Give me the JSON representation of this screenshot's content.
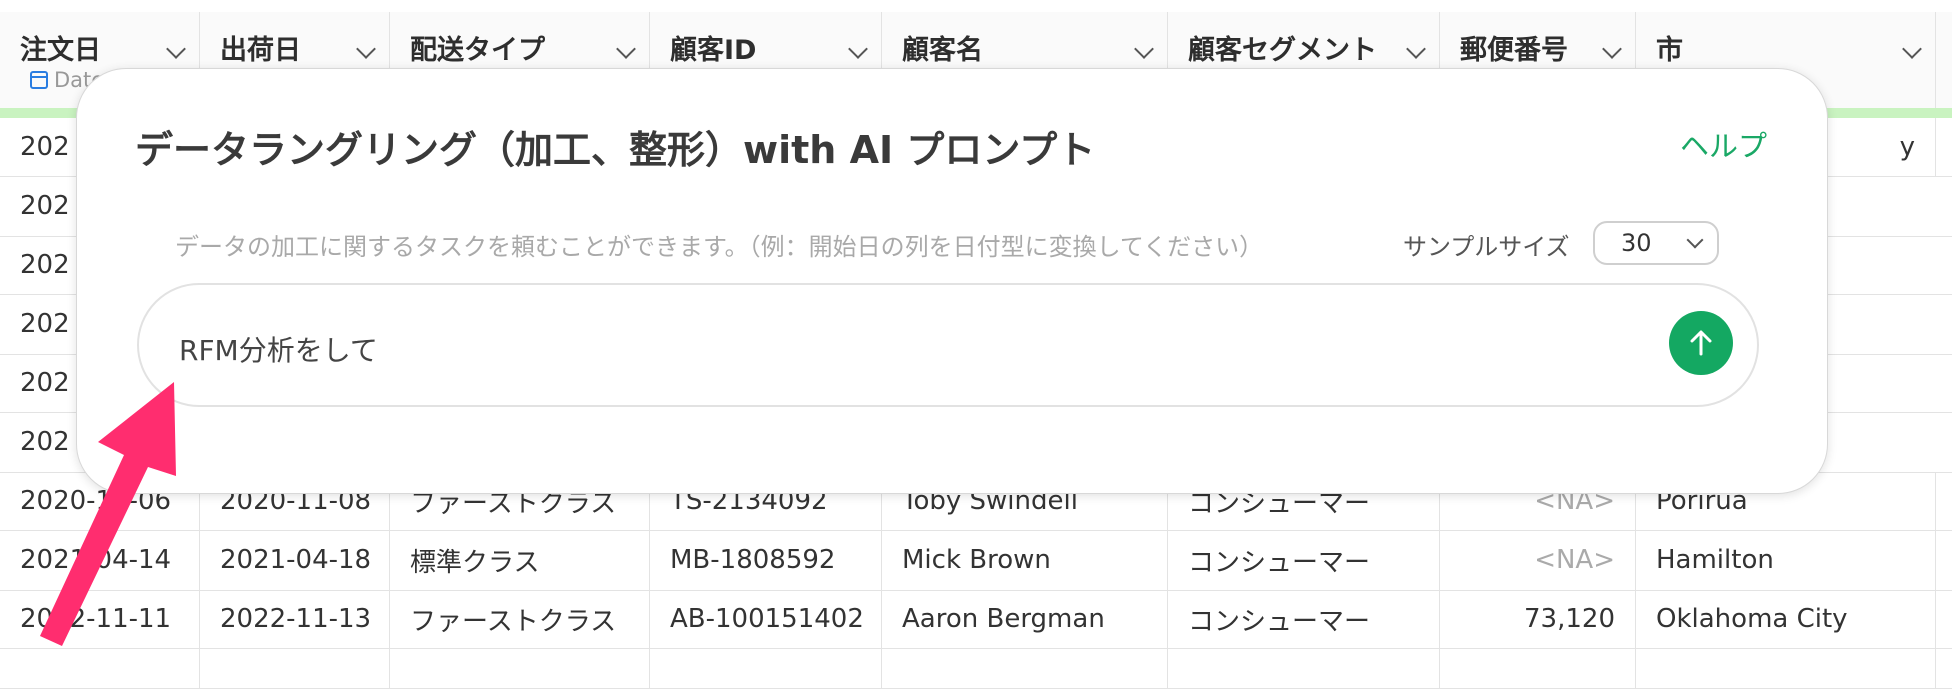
{
  "table": {
    "columns": [
      {
        "label": "注文日"
      },
      {
        "label": "出荷日"
      },
      {
        "label": "配送タイプ"
      },
      {
        "label": "顧客ID"
      },
      {
        "label": "顧客名"
      },
      {
        "label": "顧客セグメント"
      },
      {
        "label": "郵便番号"
      },
      {
        "label": "市"
      }
    ],
    "type_badge": "Date",
    "rows": [
      {
        "cells": [
          "2020-11-06",
          "2020-11-08",
          "ファーストクラス",
          "TS-2134092",
          "Toby Swindell",
          "コンシューマー",
          "<NA>",
          "Porirua"
        ]
      },
      {
        "cells": [
          "2021-04-14",
          "2021-04-18",
          "標準クラス",
          "MB-1808592",
          "Mick Brown",
          "コンシューマー",
          "<NA>",
          "Hamilton"
        ]
      },
      {
        "cells": [
          "2022-11-11",
          "2022-11-13",
          "ファーストクラス",
          "AB-100151402",
          "Aaron Bergman",
          "コンシューマー",
          "73,120",
          "Oklahoma City"
        ]
      }
    ],
    "hidden_partial": {
      "first_col_prefix": "202",
      "city_suffix": "y"
    }
  },
  "modal": {
    "title": "データラングリング（加工、整形）with AI プロンプト",
    "help_label": "ヘルプ",
    "hint": "データの加工に関するタスクを頼むことができます。（例：開始日の列を日付型に変換してください）",
    "sample_size_label": "サンプルサイズ",
    "sample_size_value": "30",
    "prompt_text": "RFM分析をして"
  },
  "colors": {
    "accent_green": "#14a862",
    "help_green": "#1aa866",
    "arrow_pink": "#ff2d6f",
    "header_highlight": "#c9f3c0"
  },
  "icons": [
    "calendar-icon",
    "chevron-down-icon",
    "arrow-up-icon"
  ]
}
